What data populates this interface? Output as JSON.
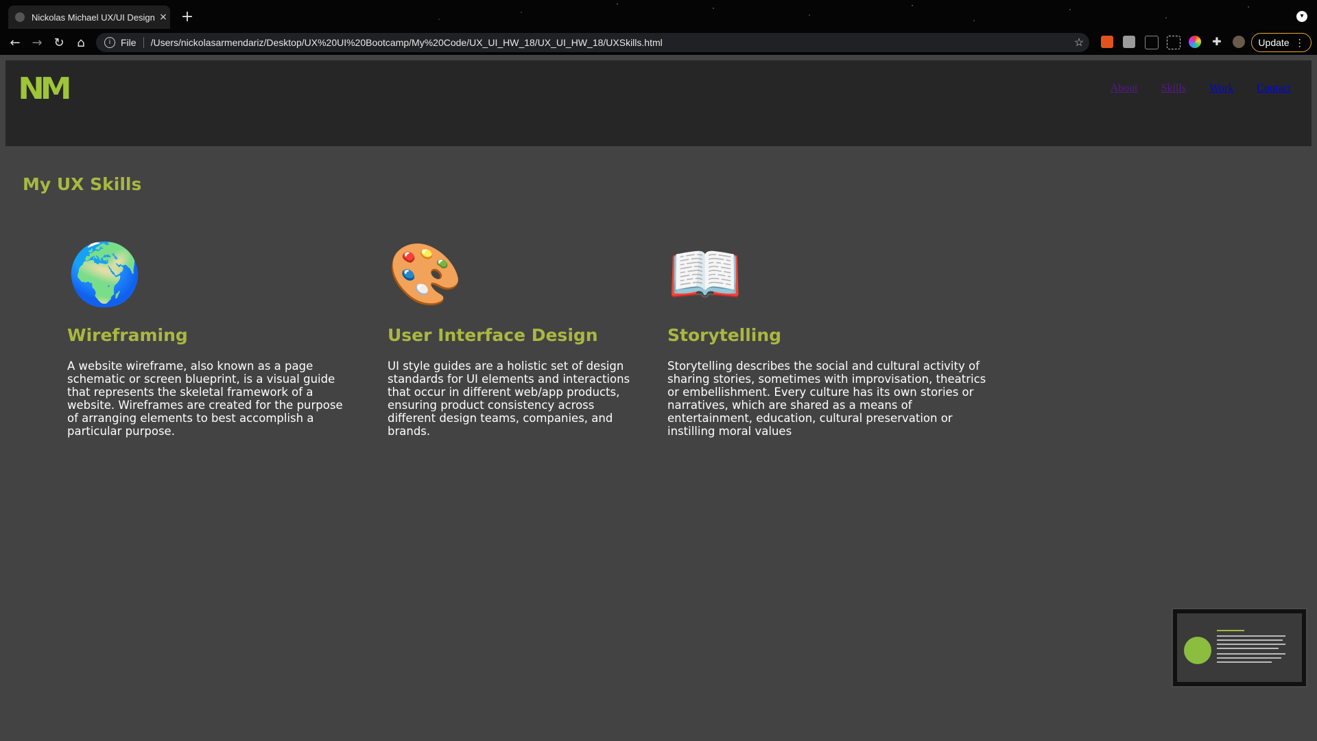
{
  "browser": {
    "tab_title": "Nickolas Michael UX/UI Design",
    "tab_close": "×",
    "new_tab": "+",
    "scheme": "File",
    "url": "/Users/nickolasarmendariz/Desktop/UX%20UI%20Bootcamp/My%20Code/UX_UI_HW_18/UX_UI_HW_18/UXSkills.html",
    "update_label": "Update",
    "accent": "#e8a93a"
  },
  "site": {
    "logo": "NM",
    "logo_color": "#9ec53a",
    "nav": [
      {
        "label": "About",
        "state": "visited"
      },
      {
        "label": "Skills",
        "state": "visited"
      },
      {
        "label": "Work",
        "state": "link"
      },
      {
        "label": "Contact",
        "state": "link"
      }
    ],
    "page_title": "My UX Skills",
    "heading_color": "#a8b940",
    "skills": [
      {
        "icon": "🌍",
        "title": "Wireframing",
        "text": "A website wireframe, also known as a page schematic or screen blueprint, is a visual guide that represents the skeletal framework of a website. Wireframes are created for the purpose of arranging elements to best accomplish a particular purpose."
      },
      {
        "icon": "🎨",
        "title": "User Interface Design",
        "text": "UI style guides are a holistic set of design standards for UI elements and interactions that occur in different web/app products, ensuring product consistency across different design teams, companies, and brands."
      },
      {
        "icon": "📖",
        "title": "Storytelling",
        "text": "Storytelling describes the social and cultural activity of sharing stories, sometimes with improvisation, theatrics or embellishment. Every culture has its own stories or narratives, which are shared as a means of entertainment, education, cultural preservation or instilling moral values"
      }
    ]
  }
}
